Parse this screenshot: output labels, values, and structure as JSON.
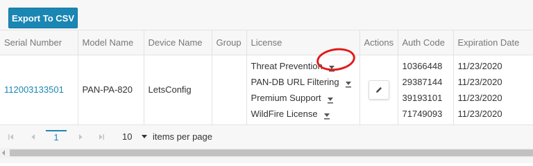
{
  "toolbar": {
    "export_label": "Export To CSV"
  },
  "grid": {
    "columns": [
      "Serial Number",
      "Model Name",
      "Device Name",
      "Group",
      "License",
      "Actions",
      "Auth Code",
      "Expiration Date"
    ],
    "row": {
      "serial": "112003133501",
      "model": "PAN-PA-820",
      "device": "LetsConfig",
      "group": "",
      "licenses": [
        "Threat Prevention",
        "PAN-DB URL Filtering",
        "Premium Support",
        "WildFire License"
      ],
      "auth_codes": [
        "10366448",
        "29387144",
        "39193101",
        "71749093"
      ],
      "expirations": [
        "11/23/2020",
        "11/23/2020",
        "11/23/2020",
        "11/23/2020"
      ]
    }
  },
  "pager": {
    "current_page": "1",
    "page_size": "10",
    "items_per_page_label": "items per page"
  },
  "colors": {
    "accent": "#1a86b4",
    "annotation": "#e21a1a"
  },
  "icons": [
    "download-icon",
    "pencil-icon",
    "first-page-icon",
    "prev-page-icon",
    "next-page-icon",
    "last-page-icon",
    "chevron-down-icon"
  ]
}
